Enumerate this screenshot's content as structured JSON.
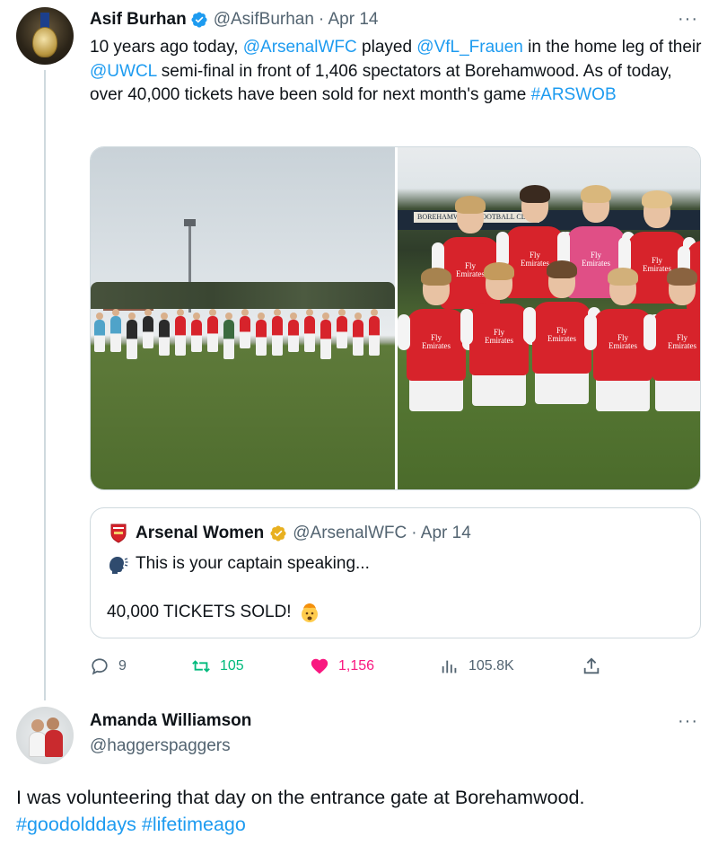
{
  "colors": {
    "link": "#1d9bf0",
    "muted": "#536471",
    "verified": "#1d9bf0",
    "gold_check": "#e8b020",
    "like": "#f91880",
    "retweet": "#00ba7c",
    "arsenal_red": "#d7232b"
  },
  "tweet": {
    "author": {
      "name": "Asif Burhan",
      "handle": "@AsifBurhan",
      "date": "· Apr 14",
      "verified_icon": "blue-check-icon"
    },
    "more_label": "···",
    "text": {
      "p1": "10 years ago today, ",
      "m1": "@ArsenalWFC",
      "p2": " played ",
      "m2": "@VfL_Frauen",
      "p3": " in the home leg of their ",
      "m3": "@UWCL",
      "p4": " semi-final in front of 1,406 spectators at Borehamwood. As of today, over 40,000 tickets have been sold for next month's game ",
      "hashtag": "#ARSWOB"
    },
    "photos": {
      "right_banner_text": "BOREHAMWOOD FOOTBALL CLUB",
      "sponsor_line1": "Fly",
      "sponsor_line2": "Emirates"
    },
    "quote": {
      "name": "Arsenal Women",
      "handle": "@ArsenalWFC",
      "date": "· Apr 14",
      "line1": "This is your captain speaking...",
      "line2": "40,000 TICKETS SOLD!"
    },
    "actions": {
      "replies": "9",
      "retweets": "105",
      "likes": "1,156",
      "views": "105.8K"
    }
  },
  "reply": {
    "name": "Amanda Williamson",
    "handle": "@haggerspaggers",
    "more_label": "···",
    "text": "I was volunteering that day on the entrance gate at Borehamwood.",
    "hashtag1": "#goodolddays",
    "hashtag2": "#lifetimeago"
  }
}
